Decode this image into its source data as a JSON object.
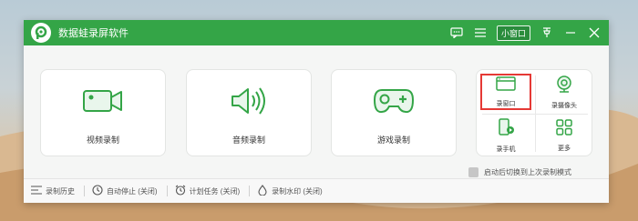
{
  "window": {
    "title": "数据蛙录屏软件",
    "mini_window_label": "小窗口"
  },
  "cards": [
    {
      "label": "视频录制",
      "icon": "video-camera-icon"
    },
    {
      "label": "音频录制",
      "icon": "speaker-icon"
    },
    {
      "label": "游戏录制",
      "icon": "gamepad-icon"
    }
  ],
  "more_panel": {
    "items": [
      {
        "label": "录窗口",
        "icon": "window-icon",
        "highlighted": true
      },
      {
        "label": "录摄像头",
        "icon": "webcam-icon"
      },
      {
        "label": "录手机",
        "icon": "phone-icon"
      },
      {
        "label": "更多",
        "icon": "grid-icon"
      }
    ]
  },
  "checkbox": {
    "label": "启动后切换到上次录制模式",
    "checked": false
  },
  "footer": {
    "items": [
      {
        "label": "录制历史",
        "icon": "list-icon"
      },
      {
        "label": "自动停止 (关闭)",
        "icon": "clock-icon"
      },
      {
        "label": "计划任务 (关闭)",
        "icon": "alarm-icon"
      },
      {
        "label": "录制水印 (关闭)",
        "icon": "watermark-icon"
      }
    ]
  },
  "colors": {
    "brand_green": "#34a547",
    "highlight_red": "#e53935"
  }
}
